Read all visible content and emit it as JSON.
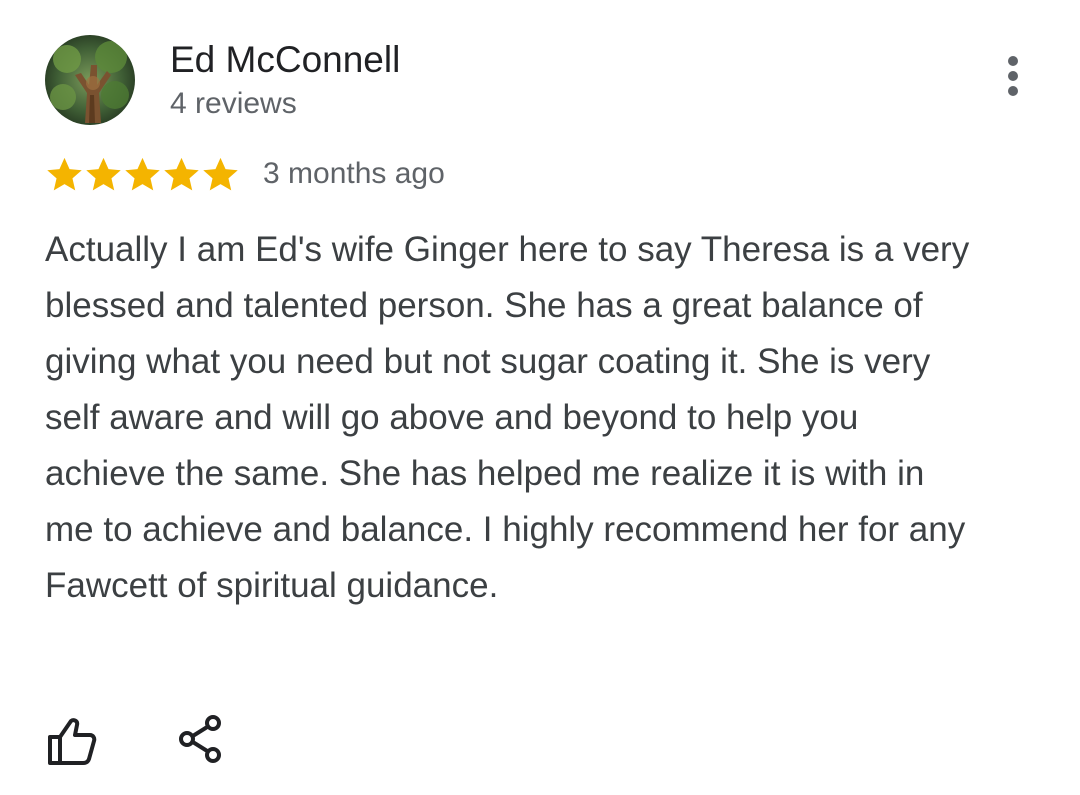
{
  "reviewer": {
    "name": "Ed McConnell",
    "review_count": "4 reviews"
  },
  "review": {
    "rating": 5,
    "rating_max": 5,
    "date": "3 months ago",
    "text": "Actually I am Ed's wife Ginger here to say Theresa is a very blessed and talented person. She has a great balance of giving what you need but not sugar coating it. She is very self aware and will go above and beyond to help you achieve the same. She has helped me realize it is with in me to achieve and balance. I highly recommend her for any Fawcett of spiritual guidance."
  },
  "icons": {
    "more": "more-vertical-icon",
    "star": "star-icon",
    "like": "thumbs-up-icon",
    "share": "share-icon"
  },
  "colors": {
    "star": "#F4B400",
    "text_primary": "#202124",
    "text_secondary": "#5f6368",
    "body_text": "#3c4043",
    "icon": "#202124"
  }
}
